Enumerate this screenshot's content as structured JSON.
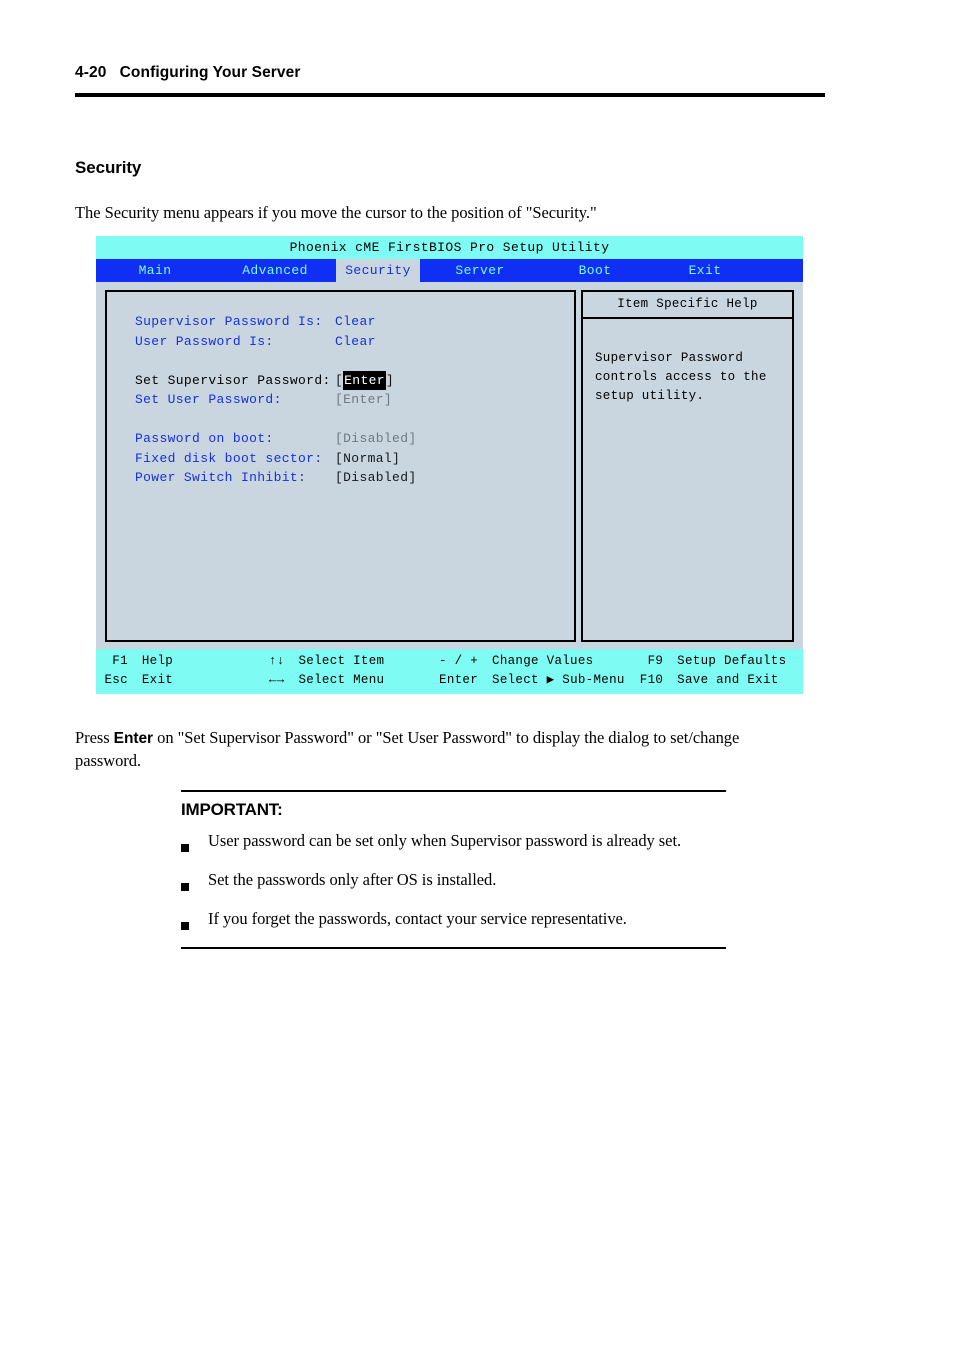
{
  "page": {
    "header": "4-20   Configuring Your Server",
    "section_title": "Security",
    "intro": "The Security menu appears if you move the cursor to the position of \"Security.\"",
    "press_prefix": "Press ",
    "press_key": "Enter",
    "press_suffix": " on \"Set Supervisor Password\" or \"Set User Password\" to display the dialog to set/change password."
  },
  "bios": {
    "title": "Phoenix cME FirstBIOS Pro Setup Utility",
    "tabs": [
      {
        "label": "Main",
        "active": false
      },
      {
        "label": "Advanced",
        "active": false
      },
      {
        "label": "Security",
        "active": true
      },
      {
        "label": "Server",
        "active": false
      },
      {
        "label": "Boot",
        "active": false
      },
      {
        "label": "Exit",
        "active": false
      }
    ],
    "options": [
      {
        "label": "Supervisor Password Is:",
        "value": "Clear"
      },
      {
        "label": "User Password Is:",
        "value": "Clear"
      },
      {
        "label": "Set Supervisor Password:",
        "value_open": "[",
        "value_hl": "Enter",
        "value_close": "]"
      },
      {
        "label": "Set User Password:",
        "value": "[Enter]"
      },
      {
        "label": "Password on boot:",
        "value": "[Disabled]"
      },
      {
        "label": "Fixed disk boot sector:",
        "value": "[Normal]"
      },
      {
        "label": "Power Switch Inhibit:",
        "value": "[Disabled]"
      }
    ],
    "help": {
      "title": "Item Specific Help",
      "line1": "Supervisor Password",
      "line2": "controls access to the",
      "line3": "setup utility."
    },
    "footer": {
      "row1": {
        "key1": "F1",
        "label1": "Help",
        "key2": "↑↓",
        "label2": "Select Item",
        "key3": "- / +",
        "label3": "Change Values",
        "key4": "F9",
        "label4": "Setup Defaults"
      },
      "row2": {
        "key1": "Esc",
        "label1": "Exit",
        "key2": "←→",
        "label2": "Select Menu",
        "key3": "Enter",
        "label3": "Select ▶ Sub-Menu",
        "key4": "F10",
        "label4": "Save and Exit"
      }
    },
    "colors": {
      "title_bar": "#7efbf2",
      "menu_bar": "#0f2ff5",
      "panel_bg": "#c9d6e0",
      "label_blue": "#1730d8",
      "footer_bar": "#7efbf2"
    }
  },
  "important": {
    "title": "IMPORTANT:",
    "items": [
      "User password can be set only when Supervisor password is already set.",
      "Set the passwords only after OS is installed.",
      "If you forget the passwords, contact your service representative."
    ]
  }
}
